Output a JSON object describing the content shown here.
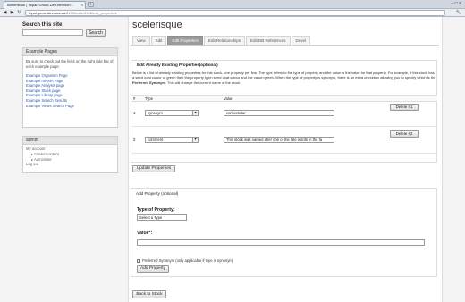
{
  "browser": {
    "tab_title": "scelerisque | Tripal: Gmod-Dev.clemson...",
    "tab_close": "×",
    "new_tab": "+",
    "url_host": "tripal.gmod-dev.aixs.ca",
    "url_path": "/8133/node/3186/edit_properties",
    "back_icon": "◀",
    "forward_icon": "▶",
    "reload_icon": "↻",
    "wrench_icon": "🔧",
    "window_controls": "–  □  ×"
  },
  "sidebar": {
    "search_title": "Search this site:",
    "search_value": "",
    "search_button": "Search",
    "example_title": "Example Pages",
    "example_intro": "Be sure to check out the links on the right side bar of each example page:",
    "example_links": [
      "Example Organism Page",
      "Example miRNA Page",
      "Example Analysis page",
      "Example Stock page",
      "Example Library page",
      "Example Search Results",
      "Example Views Search Page"
    ],
    "admin_title": "admin",
    "admin_items": [
      "My account",
      "Create content",
      "Administer",
      "Log out"
    ]
  },
  "main": {
    "title": "scelerisque",
    "tabs": [
      "View",
      "Edit",
      "Edit Properties",
      "Edit Relationships",
      "Edit DB References",
      "Devel"
    ],
    "active_tab": 2,
    "edit_legend": "Edit Already Existing Properties(optional)",
    "description_a": "Below is a list of already existing properties for this stock, one property per line. The type refers to the type of property and the value is the value for that property. For example, if this stock has a seed coat colour of green then the property type=seed coat colour and the value=green. When the type of property is synonym, there is an extra checkbox allowing you to specify which is the ",
    "description_b": "Preferred Synonym",
    "description_c": ". This will change the current name of the stock.",
    "table_headers": [
      "#",
      "Type",
      "Value"
    ],
    "rows": [
      {
        "num": "1",
        "type": "synonym",
        "value": "consectetur",
        "delete": "Delete #1"
      },
      {
        "num": "2",
        "type": "comment",
        "value": "This stock was named after one of the late words in the fa",
        "delete": "Delete #2"
      }
    ],
    "update_button": "Update Properties",
    "add_legend": "Add Property (optional)",
    "type_label": "Type of Property:",
    "type_select": "Select a Type",
    "value_label": "Value*:",
    "value_input": "",
    "preferred_label": "Preferred Synonym (only applicable if type is synonym)",
    "add_button": "Add Property",
    "back_button": "Back to Stock"
  }
}
